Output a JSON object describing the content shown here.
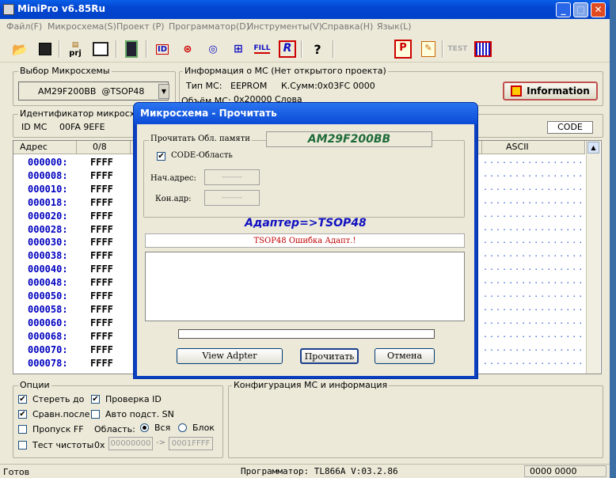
{
  "app": {
    "title": "MiniPro v6.85Ru"
  },
  "menu": [
    "Файл(F)",
    "Микросхема(S)",
    "Проект (P)",
    "Программатор(D)",
    "Инструменты(V)",
    "Справка(H)",
    "Язык(L)"
  ],
  "toolbar": {
    "prj_label": "prj",
    "id_label": "ID",
    "fill_label": "FILL",
    "test_label": "TEST"
  },
  "chip_select": {
    "label": "Выбор Микросхемы",
    "value": "AM29F200BB  @TSOP48"
  },
  "info": {
    "label": "Информация о МС (Нет открытого проекта)",
    "type_label": "Тип МС:",
    "type_value": "EEPROM",
    "checksum": "К.Сумм:0x03FC 0000",
    "size_label": "Объём МС:",
    "size_value": "0x20000 Слова",
    "button": "Information"
  },
  "identifier": {
    "label": "Идентификатор микросхемы",
    "id_label": "ID МС",
    "id_value": "00FA 9EFE",
    "code_badge": "CODE"
  },
  "grid": {
    "headers": [
      "Адрес",
      "0/8",
      "ASCII"
    ],
    "rows": [
      {
        "addr": "000000:",
        "val": "FFFF"
      },
      {
        "addr": "000008:",
        "val": "FFFF"
      },
      {
        "addr": "000010:",
        "val": "FFFF"
      },
      {
        "addr": "000018:",
        "val": "FFFF"
      },
      {
        "addr": "000020:",
        "val": "FFFF"
      },
      {
        "addr": "000028:",
        "val": "FFFF"
      },
      {
        "addr": "000030:",
        "val": "FFFF"
      },
      {
        "addr": "000038:",
        "val": "FFFF"
      },
      {
        "addr": "000040:",
        "val": "FFFF"
      },
      {
        "addr": "000048:",
        "val": "FFFF"
      },
      {
        "addr": "000050:",
        "val": "FFFF"
      },
      {
        "addr": "000058:",
        "val": "FFFF"
      },
      {
        "addr": "000060:",
        "val": "FFFF"
      },
      {
        "addr": "000068:",
        "val": "FFFF"
      },
      {
        "addr": "000070:",
        "val": "FFFF"
      },
      {
        "addr": "000078:",
        "val": "FFFF"
      }
    ],
    "ascii_fill": "................"
  },
  "dialog": {
    "title": "Микросхема - Прочитать",
    "area_label": "Прочитать Обл. памяти",
    "chip": "AM29F200BB",
    "code_area": "CODE-Область",
    "start_label": "Нач.адрес:",
    "end_label": "Кон.адр:",
    "field_placeholder": "--------",
    "adapter": "Адаптер=>TSOP48",
    "error": "TSOP48 Ошибка Адапт.!",
    "btn_view": "View Adpter",
    "btn_read": "Прочитать",
    "btn_cancel": "Отмена"
  },
  "options": {
    "label": "Опции",
    "erase": "Стереть до",
    "verify_id": "Проверка ID",
    "compare": "Сравн.после",
    "auto_sn": "Авто подст. SN",
    "skip_ff": "Пропуск FF",
    "area_label": "Область:",
    "all": "Вся",
    "block": "Блок",
    "blank": "Тест чистоты",
    "hex": "0x",
    "from": "00000000",
    "arrow": "->",
    "to": "0001FFFF"
  },
  "config": {
    "label": "Конфигурация МС и информация"
  },
  "status": {
    "left": "Готов",
    "center": "Программатор: TL866A V:03.2.86",
    "right": "0000 0000"
  },
  "colors": {
    "title_blue": "#0346d0",
    "addr_blue": "#0000c0",
    "chip_green": "#1f6b3a",
    "adapter_blue": "#1010c0",
    "error_red": "#c00000"
  }
}
